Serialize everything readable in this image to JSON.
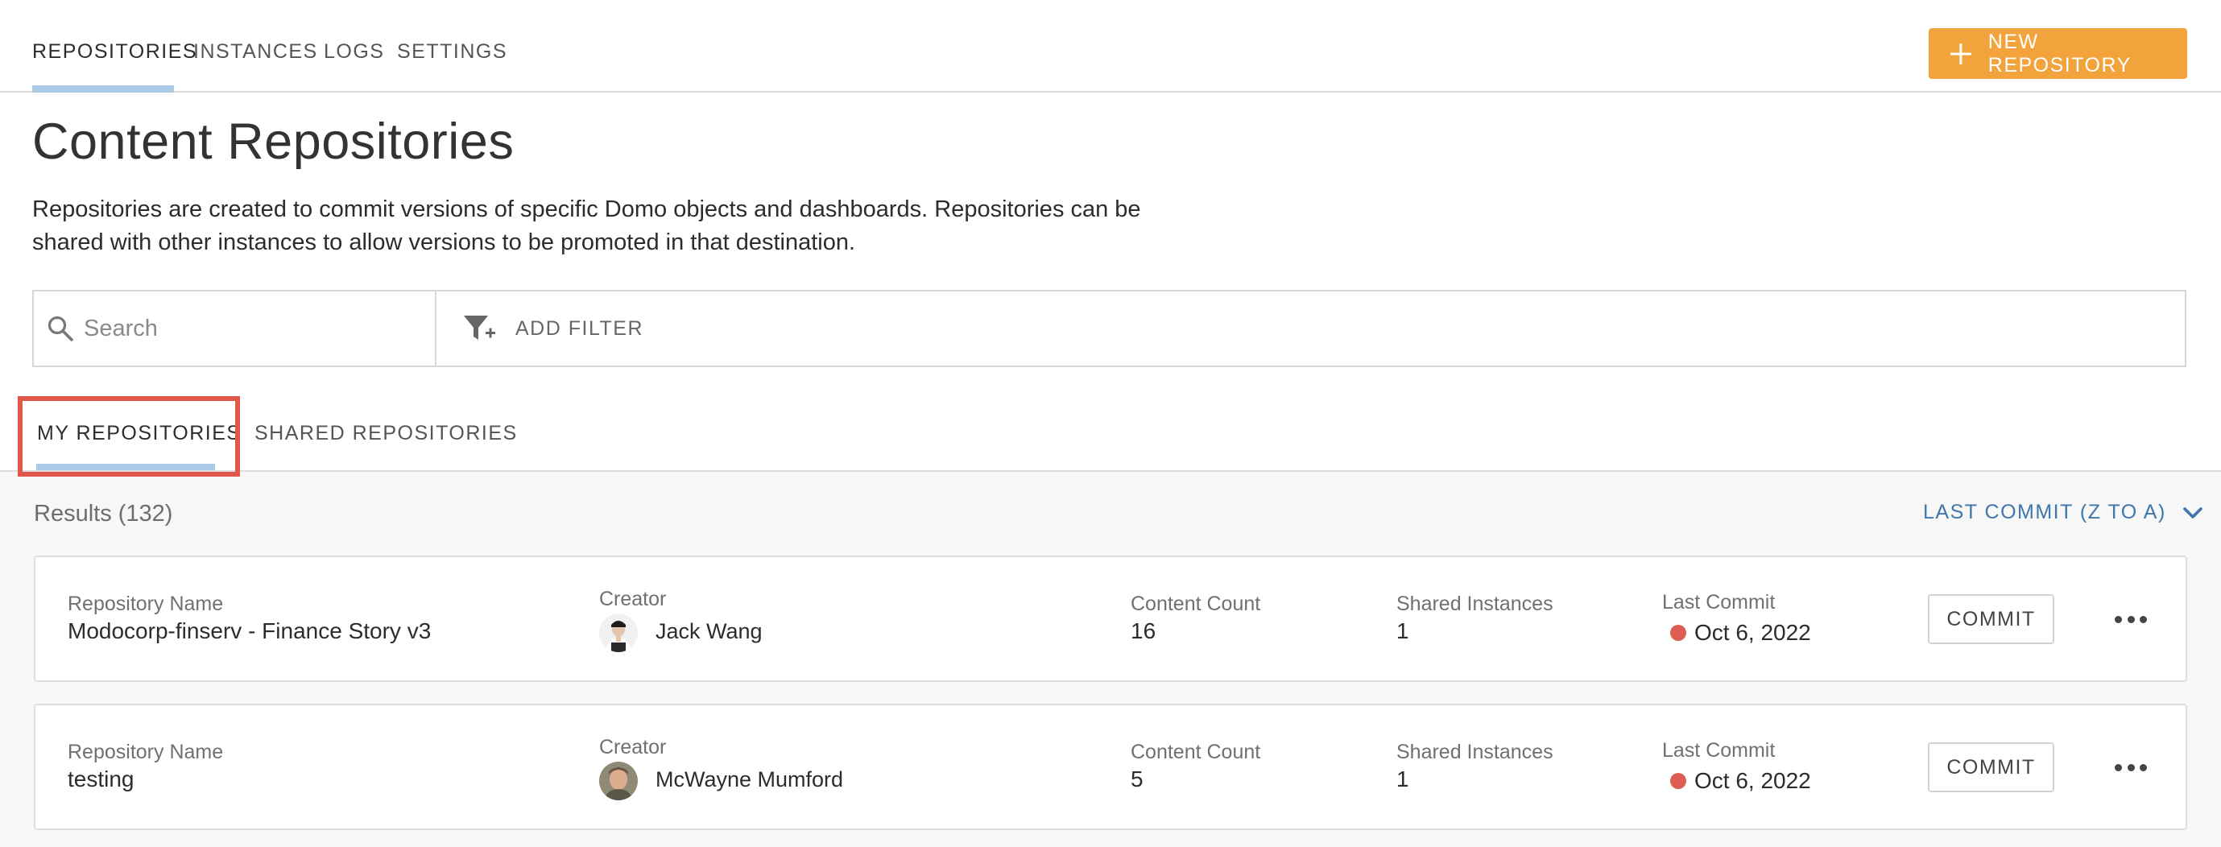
{
  "nav": {
    "tabs": [
      "REPOSITORIES",
      "INSTANCES",
      "LOGS",
      "SETTINGS"
    ],
    "active_tab": "REPOSITORIES",
    "new_button_label": "NEW REPOSITORY"
  },
  "page": {
    "title": "Content Repositories",
    "description_line1": "Repositories are created to commit versions of specific Domo objects and dashboards. Repositories can be",
    "description_line2": "shared with other instances to allow versions to be promoted in that destination."
  },
  "search": {
    "placeholder": "Search",
    "value": ""
  },
  "filter": {
    "label": "ADD FILTER"
  },
  "subtabs": {
    "items": [
      "MY REPOSITORIES",
      "SHARED REPOSITORIES"
    ],
    "active": "MY REPOSITORIES"
  },
  "results": {
    "count_label": "Results (132)",
    "sort_label": "LAST COMMIT (Z TO A)"
  },
  "columns": {
    "name": "Repository Name",
    "creator": "Creator",
    "content_count": "Content Count",
    "shared_instances": "Shared Instances",
    "last_commit": "Last Commit"
  },
  "repositories": [
    {
      "name": "Modocorp-finserv - Finance Story v3",
      "creator": "Jack Wang",
      "content_count": "16",
      "shared_instances": "1",
      "last_commit": "Oct 6, 2022",
      "commit_label": "COMMIT"
    },
    {
      "name": "testing",
      "creator": "McWayne Mumford",
      "content_count": "5",
      "shared_instances": "1",
      "last_commit": "Oct 6, 2022",
      "commit_label": "COMMIT"
    }
  ],
  "colors": {
    "accent_orange": "#f2a33c",
    "tab_underline": "#a9cbe8",
    "link_blue": "#3f77ad",
    "status_red": "#dc5e52",
    "highlight_red": "#e2574c"
  }
}
